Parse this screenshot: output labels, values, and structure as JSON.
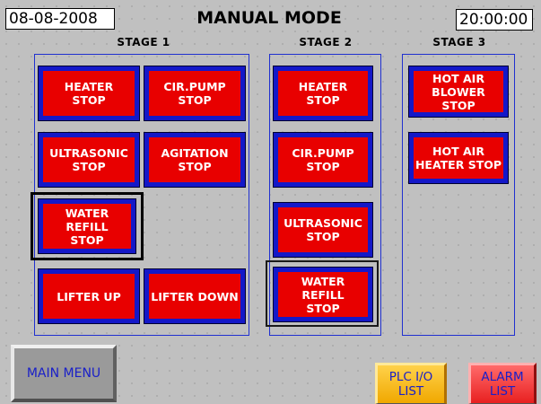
{
  "header": {
    "date": "08-08-2008",
    "title": "MANUAL MODE",
    "time": "20:00:00"
  },
  "stages": {
    "stage1_label": "STAGE 1",
    "stage2_label": "STAGE 2",
    "stage3_label": "STAGE 3"
  },
  "stage1": {
    "heater": "HEATER\nSTOP",
    "cir_pump": "CIR.PUMP\nSTOP",
    "ultrasonic": "ULTRASONIC\nSTOP",
    "agitation": "AGITATION\nSTOP",
    "water_refill": "WATER REFILL\nSTOP",
    "lifter_up": "LIFTER UP",
    "lifter_down": "LIFTER DOWN"
  },
  "stage2": {
    "heater": "HEATER\nSTOP",
    "cir_pump": "CIR.PUMP\nSTOP",
    "ultrasonic": "ULTRASONIC\nSTOP",
    "water_refill": "WATER REFILL\nSTOP"
  },
  "stage3": {
    "hot_air_blower": "HOT AIR\nBLOWER STOP",
    "hot_air_heater": "HOT AIR\nHEATER STOP"
  },
  "footer": {
    "main_menu": "MAIN MENU",
    "plc_io_list": "PLC I/O\nLIST",
    "alarm_list": "ALARM\nLIST"
  },
  "colors": {
    "button_fill": "#e80000",
    "button_border": "#1418c8",
    "panel_border": "#2030d0",
    "background": "#c0c0c0"
  }
}
